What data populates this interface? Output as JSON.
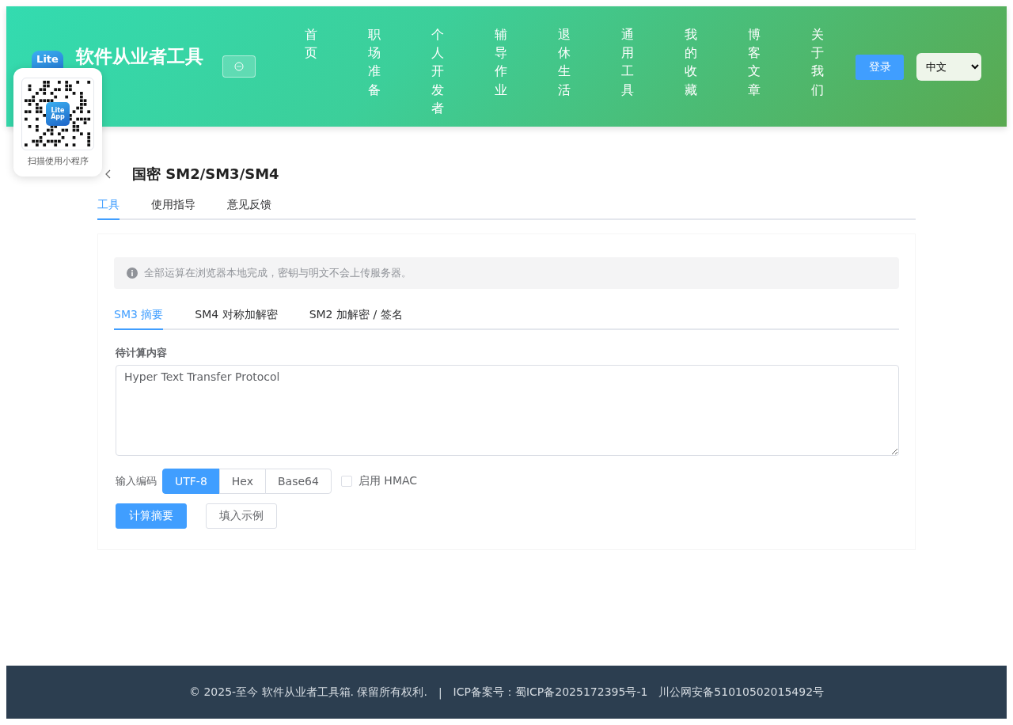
{
  "header": {
    "logo_text": "Lite",
    "site_title": "软件从业者工具",
    "nav": [
      {
        "label": "首页"
      },
      {
        "label": "职场准备"
      },
      {
        "label": "个人开发者"
      },
      {
        "label": "辅导作业"
      },
      {
        "label": "退休生活"
      },
      {
        "label": "通用工具"
      },
      {
        "label": "我的收藏"
      },
      {
        "label": "博客文章"
      },
      {
        "label": "关于我们"
      }
    ],
    "login_button": "登录",
    "language": "中文"
  },
  "qr_popup": {
    "logo_lines": [
      "Lite",
      "App"
    ],
    "caption": "扫描使用小程序"
  },
  "page": {
    "title": "国密 SM2/SM3/SM4",
    "tabs": [
      {
        "label": "工具",
        "selected": true
      },
      {
        "label": "使用指导",
        "selected": false
      },
      {
        "label": "意见反馈",
        "selected": false
      }
    ],
    "notice": "全部运算在浏览器本地完成，密钥与明文不会上传服务器。",
    "sub_tabs": [
      {
        "label": "SM3 摘要",
        "selected": true
      },
      {
        "label": "SM4 对称加解密",
        "selected": false
      },
      {
        "label": "SM2 加解密 / 签名",
        "selected": false
      }
    ],
    "input_label": "待计算内容",
    "input_value": "Hyper Text Transfer Protocol",
    "encoding_label": "输入编码",
    "encodings": [
      {
        "label": "UTF-8",
        "selected": true
      },
      {
        "label": "Hex",
        "selected": false
      },
      {
        "label": "Base64",
        "selected": false
      }
    ],
    "hmac": {
      "label": "启用 HMAC",
      "checked": false
    },
    "buttons": [
      {
        "label": "计算摘要",
        "kind": "primary"
      },
      {
        "label": "填入示例",
        "kind": "default"
      }
    ]
  },
  "footer": {
    "copyright": "© 2025-至今 软件从业者工具箱. 保留所有权利.",
    "separator": "|",
    "icp": "ICP备案号：蜀ICP备2025172395号-1",
    "police": "川公网安备51010502015492号"
  }
}
